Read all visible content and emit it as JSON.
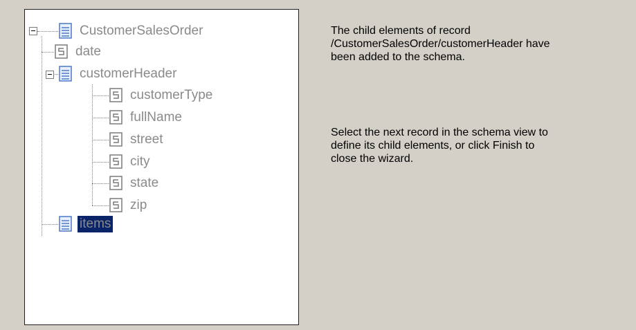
{
  "tree": {
    "nodes": [
      {
        "label": "CustomerSalesOrder",
        "type": "record"
      },
      {
        "label": "date",
        "type": "field"
      },
      {
        "label": "customerHeader",
        "type": "record"
      },
      {
        "label": "customerType",
        "type": "field"
      },
      {
        "label": "fullName",
        "type": "field"
      },
      {
        "label": "street",
        "type": "field"
      },
      {
        "label": "city",
        "type": "field"
      },
      {
        "label": "state",
        "type": "field"
      },
      {
        "label": "zip",
        "type": "field"
      },
      {
        "label": "items",
        "type": "record",
        "selected": true
      }
    ]
  },
  "info": {
    "line1": "The child elements of record",
    "line2": "/CustomerSalesOrder/customerHeader have",
    "line3": "been added to the schema.",
    "para2_line1": "Select the next record in the schema view to",
    "para2_line2": "define its child elements, or click Finish to",
    "para2_line3": "close the wizard."
  },
  "colors": {
    "background": "#d4d0c8",
    "selection": "#0a246a",
    "record_icon": "#4a78c8",
    "field_icon": "#7a7a7a"
  }
}
